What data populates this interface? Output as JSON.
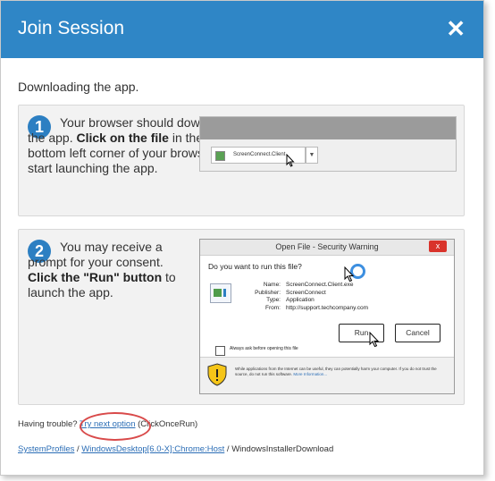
{
  "dialog": {
    "title": "Join Session",
    "close_glyph": "✕",
    "intro": "Downloading the app."
  },
  "step1": {
    "number": "1",
    "text_a": "Your browser should download the app.",
    "text_bold": "Click on the file",
    "text_b": " in the bottom left corner of your browser to start launching the app.",
    "download_filename": "ScreenConnect.Client",
    "download_arrow": "▼"
  },
  "step2": {
    "number": "2",
    "text_a": "You may receive a prompt for your consent. ",
    "text_bold1": "Click the \"Run\" button",
    "text_b": " to launch the app.",
    "warning": {
      "title": "Open File - Security Warning",
      "close": "x",
      "question": "Do you want to run this file?",
      "props": [
        {
          "k": "Name:",
          "v": "ScreenConnect.Client.exe"
        },
        {
          "k": "Publisher:",
          "v": "ScreenConnect"
        },
        {
          "k": "Type:",
          "v": "Application"
        },
        {
          "k": "From:",
          "v": "http://support.techcompany.com"
        }
      ],
      "run_label": "Run",
      "cancel_label": "Cancel",
      "checkbox_label": "Always ask before opening this file",
      "footer_note": "While applications from the Internet can be useful, they can potentially harm your computer. If you do not trust the source, do not run this software.",
      "more_info": "More Information..."
    }
  },
  "trouble": {
    "prefix": "Having trouble? ",
    "link": "Try next option",
    "suffix": " (ClickOnceRun)"
  },
  "breadcrumb": {
    "items": [
      "SystemProfiles",
      "WindowsDesktop[6.0-X]:Chrome:Host",
      "WindowsInstallerDownload"
    ],
    "separator": " / "
  },
  "colors": {
    "header": "#2f86c6",
    "accent": "#2c7fc2",
    "highlight_ring": "#d94a4a"
  }
}
